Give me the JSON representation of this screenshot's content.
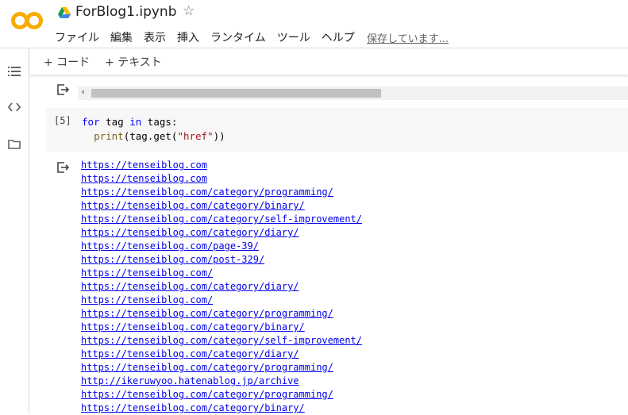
{
  "header": {
    "filename": "ForBlog1.ipynb",
    "save_status": "保存しています...",
    "menu": [
      "ファイル",
      "編集",
      "表示",
      "挿入",
      "ランタイム",
      "ツール",
      "ヘルプ"
    ]
  },
  "toolbar": {
    "add_code": "+ コード",
    "add_text": "+ テキスト"
  },
  "cell": {
    "execution_count": "[5]",
    "code_line1": {
      "kw_for": "for",
      "var1": " tag ",
      "kw_in": "in",
      "rest": " tags:"
    },
    "code_line2": {
      "indent": "  ",
      "fn": "print",
      "open": "(tag.get(",
      "str": "\"href\"",
      "close": "))"
    }
  },
  "output": {
    "links": [
      "https://tenseiblog.com",
      "https://tenseiblog.com",
      "https://tenseiblog.com/category/programming/",
      "https://tenseiblog.com/category/binary/",
      "https://tenseiblog.com/category/self-improvement/",
      "https://tenseiblog.com/category/diary/",
      "https://tenseiblog.com/page-39/",
      "https://tenseiblog.com/post-329/",
      "https://tenseiblog.com/",
      "https://tenseiblog.com/category/diary/",
      "https://tenseiblog.com/",
      "https://tenseiblog.com/category/programming/",
      "https://tenseiblog.com/category/binary/",
      "https://tenseiblog.com/category/self-improvement/",
      "https://tenseiblog.com/category/diary/",
      "https://tenseiblog.com/category/programming/",
      "http://ikeruwyoo.hatenablog.jp/archive",
      "https://tenseiblog.com/category/programming/",
      "https://tenseiblog.com/category/binary/"
    ]
  },
  "colors": {
    "logo_orange": "#f9ab00",
    "link": "#0000ee",
    "keyword_blue": "#0000ff",
    "keyword_purple": "#af00db",
    "string": "#a31515"
  },
  "icons": [
    "colab-logo-icon",
    "drive-icon",
    "star-icon",
    "table-of-contents-icon",
    "code-snippets-icon",
    "files-folder-icon",
    "output-icon"
  ]
}
